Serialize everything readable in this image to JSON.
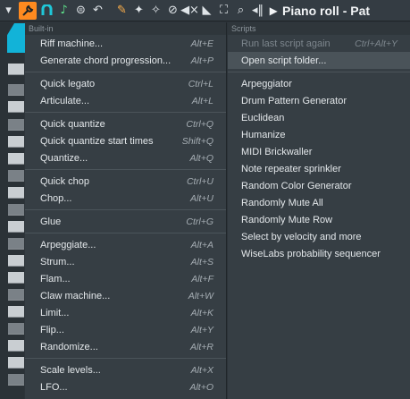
{
  "toolbar": {
    "icons": [
      "menu-arrow-icon",
      "wrench-icon",
      "magnet-icon",
      "note-icon",
      "stamp-icon",
      "undo-icon",
      "pencil-icon",
      "paint-icon",
      "delete-icon",
      "mute-icon",
      "slice-icon",
      "select-icon",
      "zoom-icon",
      "playback-icon"
    ],
    "title": "Piano roll - Pat",
    "accent": "#ff8a1f"
  },
  "builtin": {
    "header": "Built-in",
    "groups": [
      [
        {
          "label": "Riff machine...",
          "shortcut": "Alt+E"
        },
        {
          "label": "Generate chord progression...",
          "shortcut": "Alt+P"
        }
      ],
      [
        {
          "label": "Quick legato",
          "shortcut": "Ctrl+L"
        },
        {
          "label": "Articulate...",
          "shortcut": "Alt+L"
        }
      ],
      [
        {
          "label": "Quick quantize",
          "shortcut": "Ctrl+Q"
        },
        {
          "label": "Quick quantize start times",
          "shortcut": "Shift+Q"
        },
        {
          "label": "Quantize...",
          "shortcut": "Alt+Q"
        }
      ],
      [
        {
          "label": "Quick chop",
          "shortcut": "Ctrl+U"
        },
        {
          "label": "Chop...",
          "shortcut": "Alt+U"
        }
      ],
      [
        {
          "label": "Glue",
          "shortcut": "Ctrl+G"
        }
      ],
      [
        {
          "label": "Arpeggiate...",
          "shortcut": "Alt+A"
        },
        {
          "label": "Strum...",
          "shortcut": "Alt+S"
        },
        {
          "label": "Flam...",
          "shortcut": "Alt+F"
        },
        {
          "label": "Claw machine...",
          "shortcut": "Alt+W"
        },
        {
          "label": "Limit...",
          "shortcut": "Alt+K"
        },
        {
          "label": "Flip...",
          "shortcut": "Alt+Y"
        },
        {
          "label": "Randomize...",
          "shortcut": "Alt+R"
        }
      ],
      [
        {
          "label": "Scale levels...",
          "shortcut": "Alt+X"
        },
        {
          "label": "LFO...",
          "shortcut": "Alt+O"
        }
      ]
    ]
  },
  "scripts": {
    "header": "Scripts",
    "run_last": {
      "label": "Run last script again",
      "shortcut": "Ctrl+Alt+Y"
    },
    "open_folder": {
      "label": "Open script folder..."
    },
    "items": [
      "Arpeggiator",
      "Drum Pattern Generator",
      "Euclidean",
      "Humanize",
      "MIDI Brickwaller",
      "Note repeater sprinkler",
      "Random Color Generator",
      "Randomly Mute All",
      "Randomly Mute Row",
      "Select by velocity and more",
      "WiseLabs probability sequencer"
    ]
  }
}
